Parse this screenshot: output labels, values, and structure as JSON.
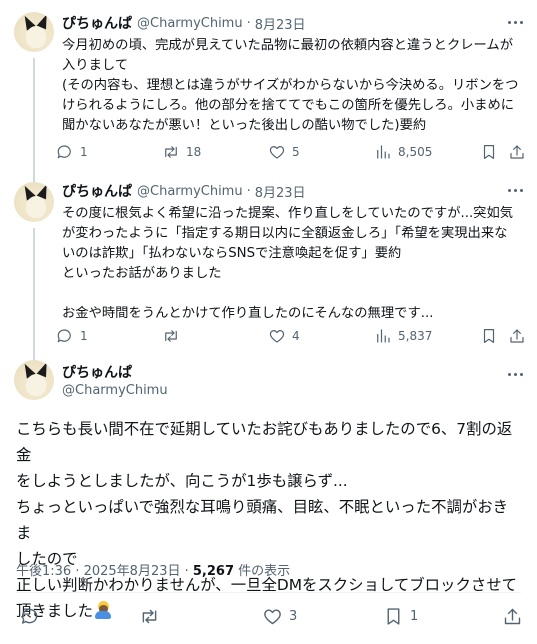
{
  "tweets": [
    {
      "name": "ぴちゅんぱ",
      "handle": "@CharmyChimu",
      "date": "8月23日",
      "text": "今月初めの頃、完成が見えていた品物に最初の依頼内容と違うとクレームが\n入りまして\n(その内容も、理想とは違うがサイズがわからないから今決める。リボンをつ\nけられるようにしろ。他の部分を捨ててでもこの箇所を優先しろ。小まめに\n聞かないあなたが悪い！といった後出しの酷い物でした)要約",
      "replies": "1",
      "retweets": "18",
      "likes": "5",
      "views": "8,505"
    },
    {
      "name": "ぴちゅんぱ",
      "handle": "@CharmyChimu",
      "date": "8月23日",
      "text": "その度に根気よく希望に沿った提案、作り直しをしていたのですが...突如気\nが変わったように「指定する期日以内に全額返金しろ」「希望を実現出来な\nいのは詐欺」「払わないならSNSで注意喚起を促す」要約\nといったお話がありました\n\nお金や時間をうんとかけて作り直したのにそんなの無理です...",
      "replies": "1",
      "retweets": "",
      "likes": "4",
      "views": "5,837"
    }
  ],
  "main": {
    "name": "ぴちゅんぱ",
    "handle": "@CharmyChimu",
    "text": "こちらも長い間不在で延期していたお詫びもありましたので6、7割の返金\nをしようとしましたが、向こうが1歩も譲らず...\nちょっといっぱいで強烈な耳鳴り頭痛、目眩、不眠といった不調がおきま\nしたので\n正しい判断かわかりませんが、一旦全DMをスクショしてブロックさせて\n頂きました",
    "time": "午後1:36 · 2025年8月23日 · ",
    "views_count": "5,267",
    "views_label": " 件の表示",
    "replies": "",
    "retweets": "",
    "likes": "3",
    "bookmarks": "1"
  },
  "colors": {
    "text": "#0f1419",
    "secondary": "#536471",
    "divider": "#eff3f4",
    "thread_line": "#cfd9de"
  },
  "icons": {
    "reply": "speech-bubble-icon",
    "retweet": "retweet-icon",
    "like": "heart-icon",
    "views": "bar-chart-icon",
    "bookmark": "bookmark-icon",
    "share": "share-icon",
    "more": "more-dots-icon",
    "emoji": "person-bowing-emoji"
  }
}
